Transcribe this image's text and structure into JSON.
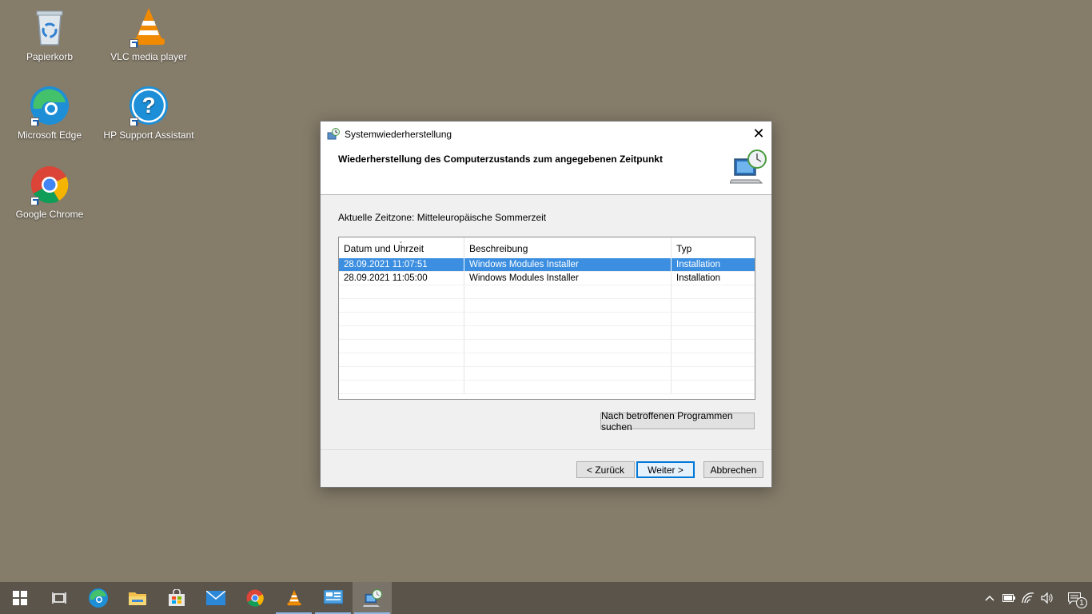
{
  "desktop": {
    "icons": [
      {
        "label": "Papierkorb",
        "icon": "recycle-bin-icon"
      },
      {
        "label": "VLC media player",
        "icon": "vlc-icon"
      },
      {
        "label": "Microsoft Edge",
        "icon": "edge-icon"
      },
      {
        "label": "HP Support Assistant",
        "icon": "hp-support-icon"
      },
      {
        "label": "Google Chrome",
        "icon": "chrome-icon"
      }
    ]
  },
  "dialog": {
    "title": "Systemwiederherstellung",
    "header_title": "Wiederherstellung des Computerzustands zum angegebenen Zeitpunkt",
    "timezone": "Aktuelle Zeitzone: Mitteleuropäische Sommerzeit",
    "table": {
      "columns": [
        "Datum und Uhrzeit",
        "Beschreibung",
        "Typ"
      ],
      "rows": [
        {
          "date": "28.09.2021 11:07:51",
          "description": "Windows Modules Installer",
          "type": "Installation",
          "selected": true
        },
        {
          "date": "28.09.2021 11:05:00",
          "description": "Windows Modules Installer",
          "type": "Installation",
          "selected": false
        }
      ]
    },
    "scan_button": "Nach betroffenen Programmen suchen",
    "back_button": "< Zurück",
    "next_button": "Weiter >",
    "cancel_button": "Abbrechen",
    "close_symbol": "✕"
  },
  "taskbar": {
    "items": [
      "start",
      "task-view",
      "edge",
      "file-explorer",
      "store",
      "mail",
      "chrome",
      "vlc",
      "control-panel",
      "system-restore"
    ],
    "notification_count": "1"
  },
  "colors": {
    "desktop_bg": "#857c6a",
    "selection": "#3b8ee0",
    "taskbar": "#5a544b",
    "accent": "#0078d7"
  }
}
